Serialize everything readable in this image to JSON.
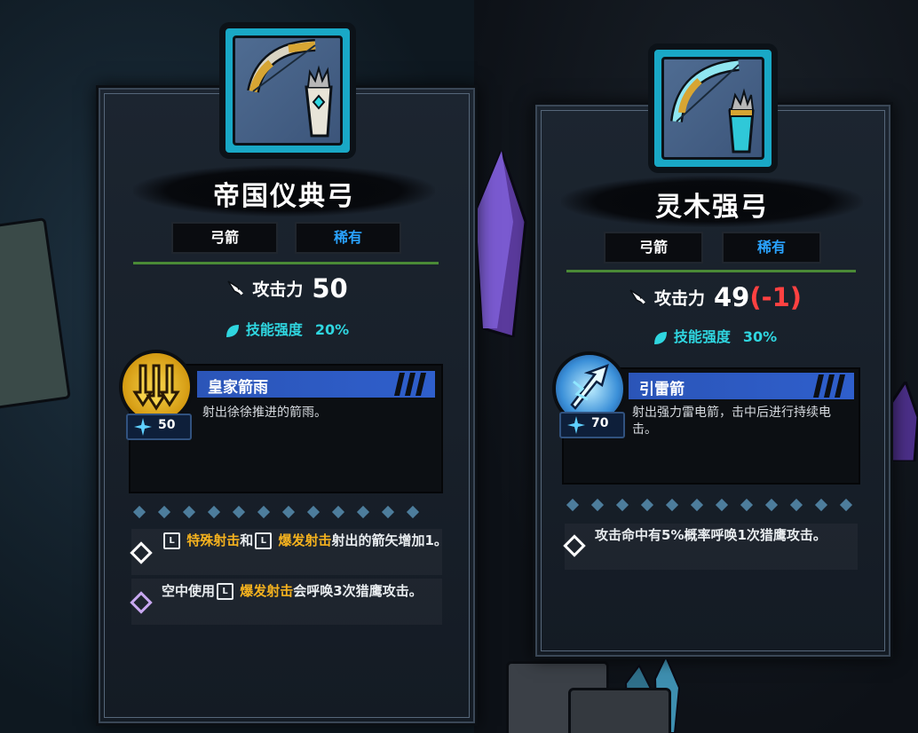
{
  "cards": [
    {
      "name": "帝国仪典弓",
      "type_tag": "弓箭",
      "rarity_tag": "稀有",
      "attack": {
        "label": "攻击力",
        "value": "50",
        "delta": ""
      },
      "skill_power": {
        "label": "技能强度",
        "value": "20%"
      },
      "skill": {
        "name": "皇家箭雨",
        "cost": "50",
        "desc": "射出徐徐推进的箭雨。"
      },
      "perks": [
        {
          "parts": [
            {
              "t": "key",
              "v": "L"
            },
            {
              "t": "hl",
              "v": " 特殊射击"
            },
            {
              "t": "txt",
              "v": "和"
            },
            {
              "t": "key",
              "v": "L"
            },
            {
              "t": "hl",
              "v": " 爆发射击"
            },
            {
              "t": "txt",
              "v": "射出的箭矢增加1。"
            }
          ]
        },
        {
          "parts": [
            {
              "t": "txt",
              "v": "空中使用"
            },
            {
              "t": "key",
              "v": "L"
            },
            {
              "t": "hl",
              "v": " 爆发射击"
            },
            {
              "t": "txt",
              "v": "会呼唤3次猎鹰攻击。"
            }
          ]
        }
      ]
    },
    {
      "name": "灵木强弓",
      "type_tag": "弓箭",
      "rarity_tag": "稀有",
      "attack": {
        "label": "攻击力",
        "value": "49",
        "delta": "(-1)"
      },
      "skill_power": {
        "label": "技能强度",
        "value": "30%"
      },
      "skill": {
        "name": "引雷箭",
        "cost": "70",
        "desc": "射出强力雷电箭，击中后进行持续电击。"
      },
      "perks": [
        {
          "parts": [
            {
              "t": "txt",
              "v": "攻击命中有5%概率呼唤1次猎鹰攻击。"
            }
          ]
        }
      ]
    }
  ],
  "colors": {
    "rarity": "#2aa3ff",
    "highlight": "#f5b21e",
    "power": "#2fd6e0",
    "delta": "#ff4141",
    "skill_bar": "#2f5fcc"
  },
  "icons": {
    "weapon_1": "golden-bow-icon",
    "weapon_2": "ice-bow-icon",
    "skill_1": "arrow-rain-icon",
    "skill_2": "lightning-arrow-icon",
    "attack": "sword-icon",
    "power": "leaf-icon"
  }
}
